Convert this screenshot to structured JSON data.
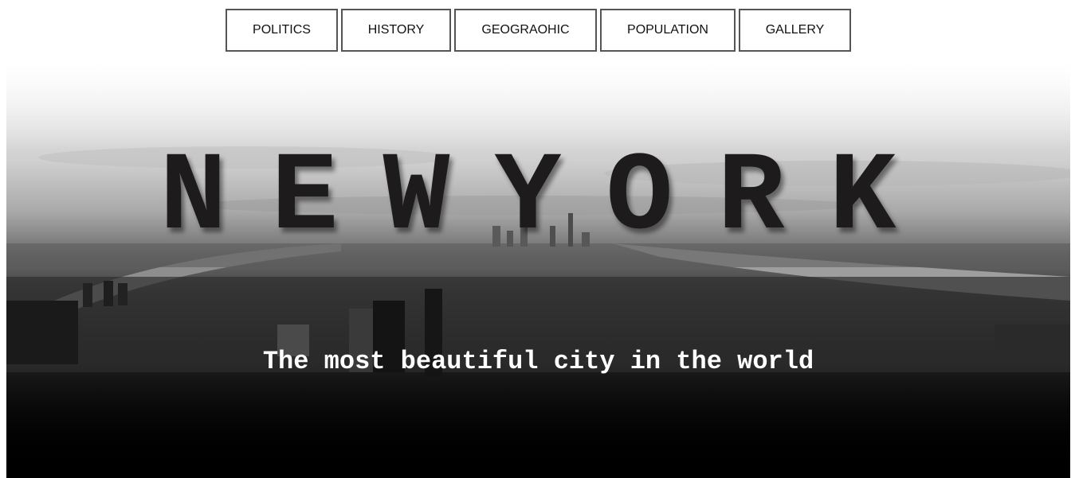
{
  "nav": {
    "items": [
      {
        "label": "POLITICS"
      },
      {
        "label": "HISTORY"
      },
      {
        "label": "GEOGRAOHIC"
      },
      {
        "label": "POPULATION"
      },
      {
        "label": "GALLERY"
      }
    ]
  },
  "hero": {
    "title": "NEWYORK",
    "subtitle": "The most beautiful city in the world",
    "image": "new-york-skyline-aerial-grayscale"
  }
}
